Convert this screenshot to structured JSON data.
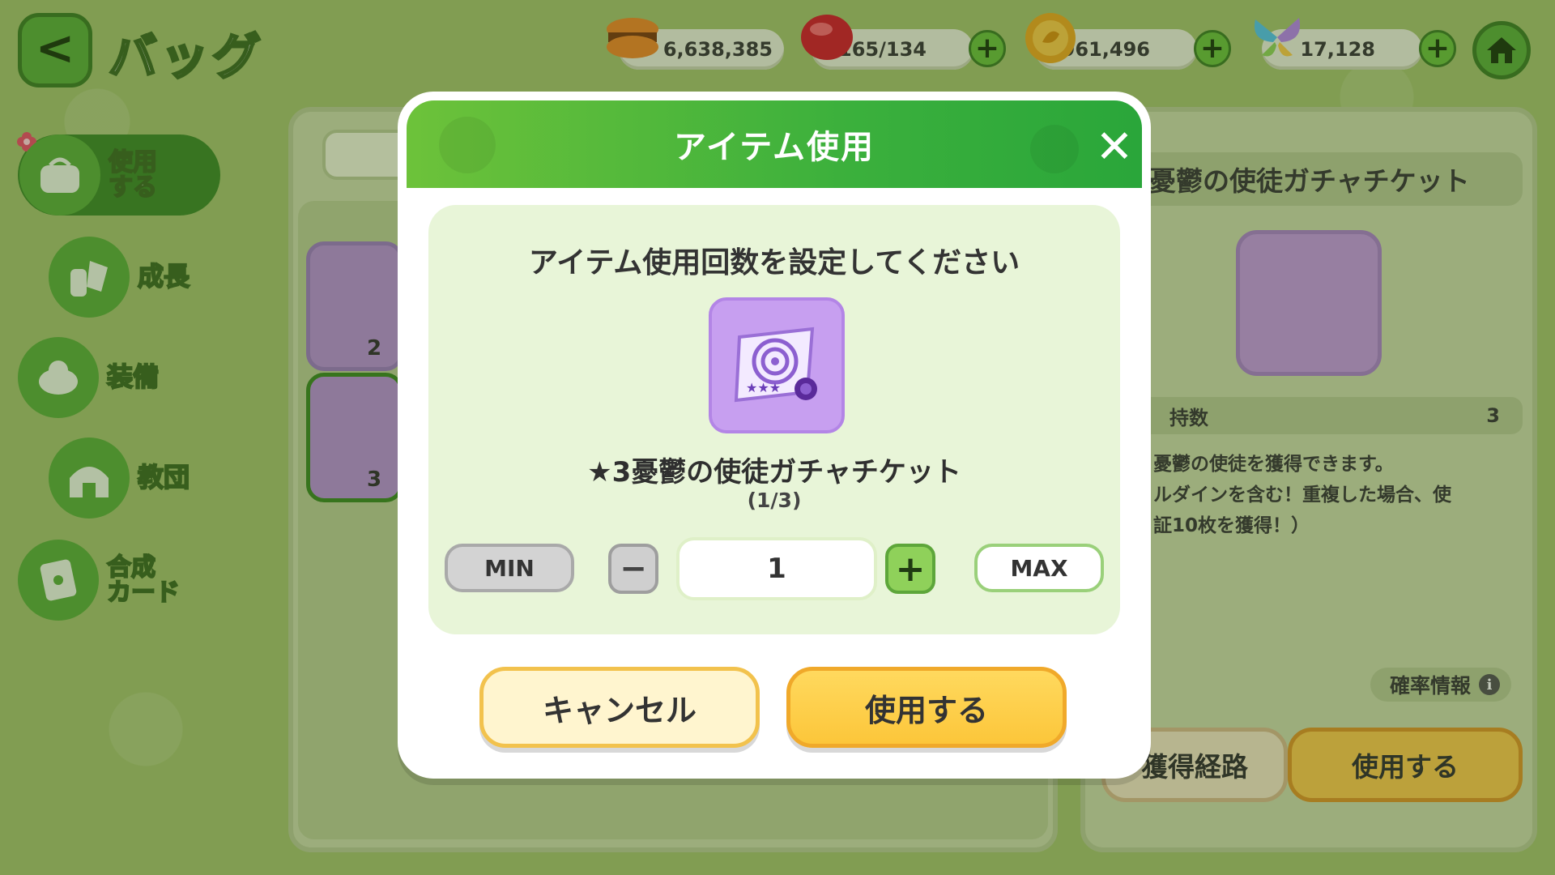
{
  "header": {
    "back_label": "<",
    "title": "バッグ"
  },
  "currencies": [
    {
      "icon": "macaron-icon",
      "value": "6,638,385",
      "has_plus": false
    },
    {
      "icon": "red-gem-icon",
      "value": "165/134",
      "has_plus": true
    },
    {
      "icon": "gold-coin-icon",
      "value": "1,961,496",
      "has_plus": true
    },
    {
      "icon": "butterfly-icon",
      "value": "17,128",
      "has_plus": true
    }
  ],
  "plus_glyph": "+",
  "sidebar": {
    "items": [
      {
        "label": "使用\nする",
        "icon": "use-bag-icon",
        "active": true
      },
      {
        "label": "成長",
        "icon": "growth-icon",
        "active": false
      },
      {
        "label": "装備",
        "icon": "equipment-icon",
        "active": false
      },
      {
        "label": "教団",
        "icon": "cult-icon",
        "active": false
      },
      {
        "label": "合成\nカード",
        "icon": "synthesis-card-icon",
        "active": false
      }
    ]
  },
  "inventory": {
    "slots": [
      {
        "count": "2"
      },
      {
        "count": "3"
      }
    ]
  },
  "detail": {
    "item_name": "3憂鬱の使徒ガチャチケット",
    "owned_label": "持数",
    "owned_value": "3",
    "description": "憂鬱の使徒を獲得できます。\nルダインを含む！重複した場合、使\n証10枚を獲得！）",
    "probability_label": "確率情報",
    "info_glyph": "i",
    "obtain_label": "獲得経路",
    "use_label": "使用する"
  },
  "modal": {
    "title": "アイテム使用",
    "close_glyph": "✕",
    "prompt": "アイテム使用回数を設定してください",
    "item_name": "★3憂鬱の使徒ガチャチケット",
    "item_count": "(1/3)",
    "min_label": "MIN",
    "minus_glyph": "−",
    "quantity": "1",
    "plus_glyph": "+",
    "max_label": "MAX",
    "cancel_label": "キャンセル",
    "use_label": "使用する"
  },
  "colors": {
    "background": "#a4c36e",
    "header_green": "#3bb03c",
    "ticket_purple": "#c79ff0",
    "use_button_yellow": "#fcc63a"
  }
}
